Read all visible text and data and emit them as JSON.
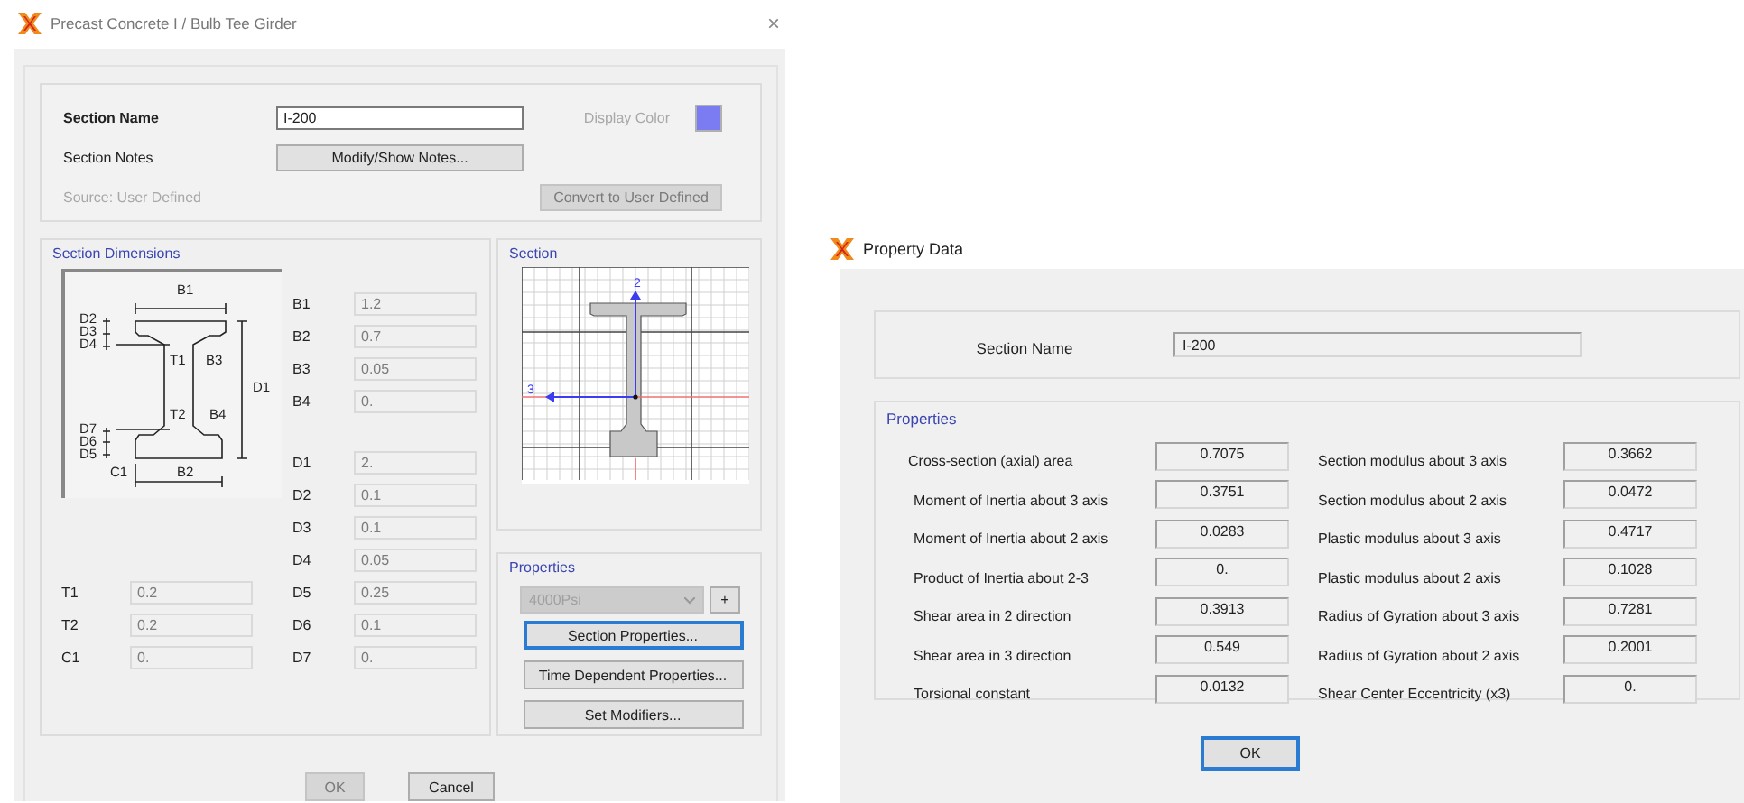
{
  "left_dialog": {
    "title": "Precast Concrete I / Bulb Tee Girder",
    "close": "×",
    "section_name": {
      "label": "Section Name",
      "value": "I-200"
    },
    "display_color": {
      "label": "Display Color",
      "color": "#7b7cf2"
    },
    "section_notes": {
      "label": "Section Notes",
      "button": "Modify/Show Notes..."
    },
    "source": "Source:  User Defined",
    "convert_button": {
      "label": "Convert to User Defined",
      "disabled": true
    },
    "dimensions": {
      "title": "Section Dimensions",
      "diagram_labels": [
        "B1",
        "D2",
        "D3",
        "D4",
        "T1",
        "B3",
        "D1",
        "D7",
        "D6",
        "D5",
        "T2",
        "B4",
        "C1",
        "B2"
      ],
      "b_fields": [
        {
          "label": "B1",
          "value": "1.2",
          "disabled": true
        },
        {
          "label": "B2",
          "value": "0.7",
          "disabled": true
        },
        {
          "label": "B3",
          "value": "0.05",
          "disabled": true
        },
        {
          "label": "B4",
          "value": "0.",
          "disabled": true
        }
      ],
      "d_fields": [
        {
          "label": "D1",
          "value": "2.",
          "disabled": true
        },
        {
          "label": "D2",
          "value": "0.1",
          "disabled": true
        },
        {
          "label": "D3",
          "value": "0.1",
          "disabled": true
        },
        {
          "label": "D4",
          "value": "0.05",
          "disabled": true
        },
        {
          "label": "D5",
          "value": "0.25",
          "disabled": true
        },
        {
          "label": "D6",
          "value": "0.1",
          "disabled": true
        },
        {
          "label": "D7",
          "value": "0.",
          "disabled": true
        }
      ],
      "t_fields": [
        {
          "label": "T1",
          "value": "0.2",
          "disabled": true
        },
        {
          "label": "T2",
          "value": "0.2",
          "disabled": true
        },
        {
          "label": "C1",
          "value": "0.",
          "disabled": true
        }
      ]
    },
    "section": {
      "title": "Section",
      "axis_labels": [
        "2",
        "3"
      ]
    },
    "properties": {
      "title": "Properties",
      "material": {
        "value": "4000Psi",
        "disabled": true
      },
      "add_button": "+",
      "buttons": [
        {
          "label": "Section Properties...",
          "focused": true
        },
        {
          "label": "Time Dependent Properties...",
          "focused": false
        },
        {
          "label": "Set Modifiers...",
          "focused": false
        }
      ]
    },
    "ok_button": {
      "label": "OK",
      "disabled": true
    },
    "cancel_button": {
      "label": "Cancel",
      "disabled": false
    }
  },
  "right_dialog": {
    "title": "Property Data",
    "section_name": {
      "label": "Section Name",
      "value": "I-200"
    },
    "properties": {
      "title": "Properties",
      "left": [
        {
          "label": "Cross-section (axial) area",
          "value": "0.7075"
        },
        {
          "label": "Moment of Inertia about 3 axis",
          "value": "0.3751"
        },
        {
          "label": "Moment of Inertia about 2 axis",
          "value": "0.0283"
        },
        {
          "label": "Product of Inertia about 2-3",
          "value": "0."
        },
        {
          "label": "Shear area in 2 direction",
          "value": "0.3913"
        },
        {
          "label": "Shear area in 3 direction",
          "value": "0.549"
        },
        {
          "label": "Torsional constant",
          "value": "0.0132"
        }
      ],
      "right": [
        {
          "label": "Section modulus about 3 axis",
          "value": "0.3662"
        },
        {
          "label": "Section modulus about 2 axis",
          "value": "0.0472"
        },
        {
          "label": "Plastic modulus about 3 axis",
          "value": "0.4717"
        },
        {
          "label": "Plastic modulus about 2 axis",
          "value": "0.1028"
        },
        {
          "label": "Radius of Gyration about 3 axis",
          "value": "0.7281"
        },
        {
          "label": "Radius of Gyration about 2 axis",
          "value": "0.2001"
        },
        {
          "label": "Shear Center Eccentricity (x3)",
          "value": "0."
        }
      ]
    },
    "ok_button": {
      "label": "OK",
      "focused": true
    }
  }
}
